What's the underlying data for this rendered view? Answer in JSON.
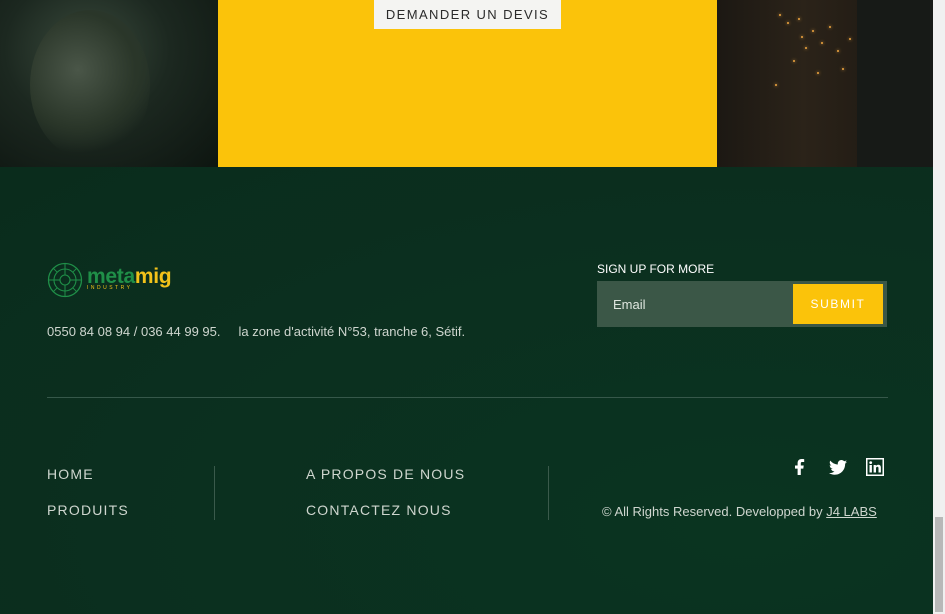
{
  "hero": {
    "quote_button_label": "DEMANDER UN DEVIS",
    "band_color": "#fbc30a"
  },
  "brand": {
    "logo_word_part1": "meta",
    "logo_word_part2": "mig",
    "logo_subtitle": "INDUSTRY",
    "primary_color": "#1f8f48",
    "accent_color": "#f2c21a"
  },
  "contact": {
    "phones": "0550 84 08 94 / 036 44 99 95.",
    "address": "la zone d'activité N°53, tranche 6, Sétif."
  },
  "signup": {
    "title": "SIGN UP FOR MORE",
    "email_placeholder": "Email",
    "submit_label": "SUBMIT"
  },
  "nav": {
    "home": "HOME",
    "produits": "PRODUITS",
    "about": "A PROPOS DE NOUS",
    "contact": "CONTACTEZ NOUS"
  },
  "social": {
    "icons": [
      "facebook-icon",
      "twitter-icon",
      "linkedin-icon"
    ]
  },
  "footer": {
    "copyright_prefix": "© All Rights Reserved. Developped by ",
    "developer_link": "J4 LABS",
    "background_color": "#0b2f1f"
  }
}
